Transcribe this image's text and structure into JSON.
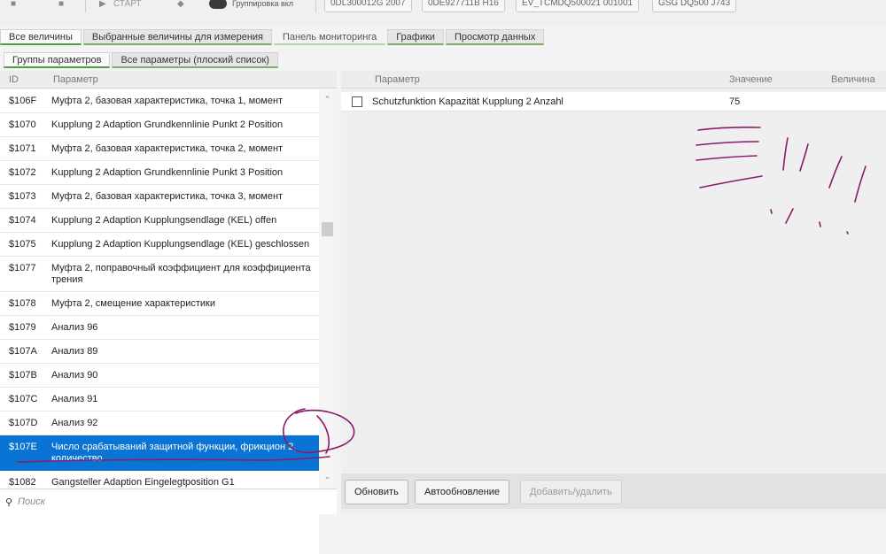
{
  "toolbar": {
    "start_label": "СТАРТ",
    "group_label": "Группировка вкл",
    "chips": [
      "0DL300012G 2007",
      "0DE927711B H16",
      "EV_TCMDQ500021 001001",
      "GSG DQ500 J743"
    ]
  },
  "main_tabs": [
    "Все величины",
    "Выбранные величины для измерения",
    "Панель мониторинга",
    "Графики",
    "Просмотр данных"
  ],
  "sub_tabs": [
    "Группы параметров",
    "Все параметры (плоский список)"
  ],
  "list": {
    "col_id": "ID",
    "col_param": "Параметр",
    "rows": [
      {
        "id": "$106F",
        "name": "Муфта 2, базовая характеристика, точка 1, момент"
      },
      {
        "id": "$1070",
        "name": "Kupplung 2 Adaption Grundkennlinie Punkt 2 Position"
      },
      {
        "id": "$1071",
        "name": "Муфта 2, базовая характеристика, точка 2, момент"
      },
      {
        "id": "$1072",
        "name": "Kupplung 2 Adaption Grundkennlinie Punkt 3 Position"
      },
      {
        "id": "$1073",
        "name": "Муфта 2, базовая характеристика, точка 3, момент"
      },
      {
        "id": "$1074",
        "name": "Kupplung 2 Adaption Kupplungsendlage (KEL) offen"
      },
      {
        "id": "$1075",
        "name": "Kupplung 2 Adaption Kupplungsendlage (KEL) geschlossen"
      },
      {
        "id": "$1077",
        "name": "Муфта 2, поправочный коэффициент для коэффициента трения"
      },
      {
        "id": "$1078",
        "name": "Муфта 2, смещение характеристики"
      },
      {
        "id": "$1079",
        "name": "Анализ 96"
      },
      {
        "id": "$107A",
        "name": "Анализ 89"
      },
      {
        "id": "$107B",
        "name": "Анализ 90"
      },
      {
        "id": "$107C",
        "name": "Анализ 91"
      },
      {
        "id": "$107D",
        "name": "Анализ 92"
      },
      {
        "id": "$107E",
        "name": "Число срабатываний защитной функции, фрикцион 2, количество"
      },
      {
        "id": "$1082",
        "name": "Gangsteller Adaption Eingelegtposition G1"
      }
    ],
    "selected_id": "$107E"
  },
  "search": {
    "placeholder": "Поиск",
    "icon": "search-icon"
  },
  "right": {
    "col_param": "Параметр",
    "col_value": "Значение",
    "col_unit": "Величина",
    "rows": [
      {
        "name": "Schutzfunktion Kapazität Kupplung 2 Anzahl",
        "value": "75",
        "unit": ""
      }
    ]
  },
  "buttons": {
    "refresh": "Обновить",
    "auto_refresh": "Автообновление",
    "add_remove": "Добавить/удалить"
  },
  "colors": {
    "accent_green": "#4f9f3f",
    "selection_blue": "#0a74d4",
    "annotation_ink": "#8b1a6b"
  }
}
